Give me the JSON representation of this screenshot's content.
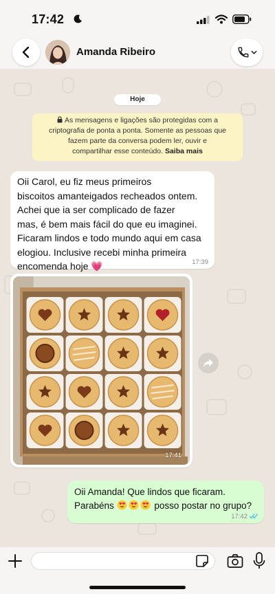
{
  "status_bar": {
    "time": "17:42"
  },
  "header": {
    "contact_name": "Amanda Ribeiro"
  },
  "chat": {
    "date_label": "Hoje",
    "encryption_notice": {
      "lines": [
        "As mensagens e ligações são protegidas com a",
        "criptografia de ponta a ponta. Somente as pessoas que",
        "fazem parte da conversa podem ler, ouvir e",
        "compartilhar esse conteúdo."
      ],
      "link_text": "Saiba mais"
    },
    "messages": [
      {
        "direction": "incoming",
        "lines": [
          "Oii Carol, eu fiz meus primeiros",
          "biscoitos amanteigados recheados ontem.",
          "Achei que ia ser complicado de fazer",
          "mas, é bem mais fácil do que eu imaginei.",
          "Ficaram lindos e todo mundo aqui em casa",
          "elogiou. Inclusive recebi minha primeira",
          "encomenda hoje"
        ],
        "emoji": "💗",
        "time": "17:39"
      },
      {
        "direction": "incoming",
        "type": "photo",
        "time": "17:41"
      },
      {
        "direction": "outgoing",
        "line1": "Oii Amanda! Que lindos que ficaram.",
        "line2_pre": "Parabéns",
        "line2_post": "posso postar no grupo?",
        "emoji_count": 3,
        "time": "17:42",
        "read_receipt": "double-check-read"
      }
    ]
  },
  "colors": {
    "incoming_bubble": "#ffffff",
    "outgoing_bubble": "#d8fdd2",
    "notice_bubble": "#fdf4c5",
    "chat_background": "#ebe5dd",
    "read_check": "#53bdeb"
  }
}
